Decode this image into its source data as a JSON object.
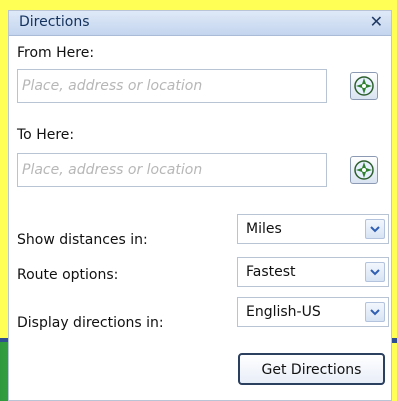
{
  "window": {
    "title": "Directions"
  },
  "icons": {
    "close": "close-icon",
    "locate": "locate-icon",
    "dropdown": "chevron-down-icon"
  },
  "from": {
    "label": "From Here:",
    "placeholder": "Place, address or location",
    "value": ""
  },
  "to": {
    "label": "To Here:",
    "placeholder": "Place, address or location",
    "value": ""
  },
  "options": {
    "distances": {
      "label": "Show distances in:",
      "value": "Miles"
    },
    "route": {
      "label": "Route options:",
      "value": "Fastest"
    },
    "language": {
      "label": "Display directions in:",
      "value": "English-US"
    }
  },
  "actions": {
    "get_directions": "Get Directions"
  },
  "colors": {
    "background": "#ffff55",
    "accent_green": "#4cb849",
    "title_bar": "#c3d5ee",
    "button_border": "#2b3f5f"
  }
}
